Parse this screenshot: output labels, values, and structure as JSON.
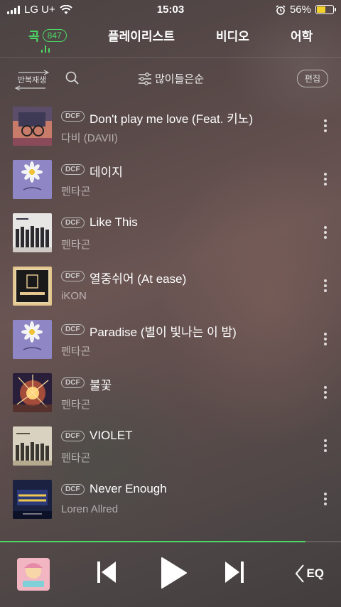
{
  "status_bar": {
    "carrier": "LG U+",
    "time": "15:03",
    "battery_percent": "56%",
    "battery_level": 0.56,
    "icons": [
      "signal-icon",
      "wifi-icon",
      "alarm-icon",
      "battery-icon"
    ]
  },
  "tabs": [
    {
      "label": "곡",
      "count": "847",
      "active": true
    },
    {
      "label": "플레이리스트",
      "active": false
    },
    {
      "label": "비디오",
      "active": false
    },
    {
      "label": "어학",
      "active": false
    }
  ],
  "toolbar": {
    "repeat_label": "반복재생",
    "sort_label": "많이들은순",
    "edit_label": "편집",
    "icons": [
      "search-icon",
      "sort-sliders-icon",
      "repeat-icon"
    ]
  },
  "songs": [
    {
      "badge": "DCF",
      "title": "Don't play me love (Feat. 키노)",
      "artist": "다비 (DAVII)",
      "art": "davii"
    },
    {
      "badge": "DCF",
      "title": "데이지",
      "artist": "펜타곤",
      "art": "daisy"
    },
    {
      "badge": "DCF",
      "title": "Like This",
      "artist": "펜타곤",
      "art": "pentagon-group"
    },
    {
      "badge": "DCF",
      "title": "열중쉬어 (At ease)",
      "artist": "iKON",
      "art": "ikon"
    },
    {
      "badge": "DCF",
      "title": "Paradise (별이 빛나는 이 밤)",
      "artist": "펜타곤",
      "art": "daisy"
    },
    {
      "badge": "DCF",
      "title": "불꽃",
      "artist": "펜타곤",
      "art": "fireworks"
    },
    {
      "badge": "DCF",
      "title": "VIOLET",
      "artist": "펜타곤",
      "art": "pentagon-group"
    },
    {
      "badge": "DCF",
      "title": "Never Enough",
      "artist": "Loren Allred",
      "art": "showman"
    }
  ],
  "player": {
    "progress": 0.895,
    "accent_color": "#4cd964",
    "eq_label": "EQ",
    "icons": [
      "previous-icon",
      "play-icon",
      "next-icon",
      "eq-icon"
    ]
  }
}
